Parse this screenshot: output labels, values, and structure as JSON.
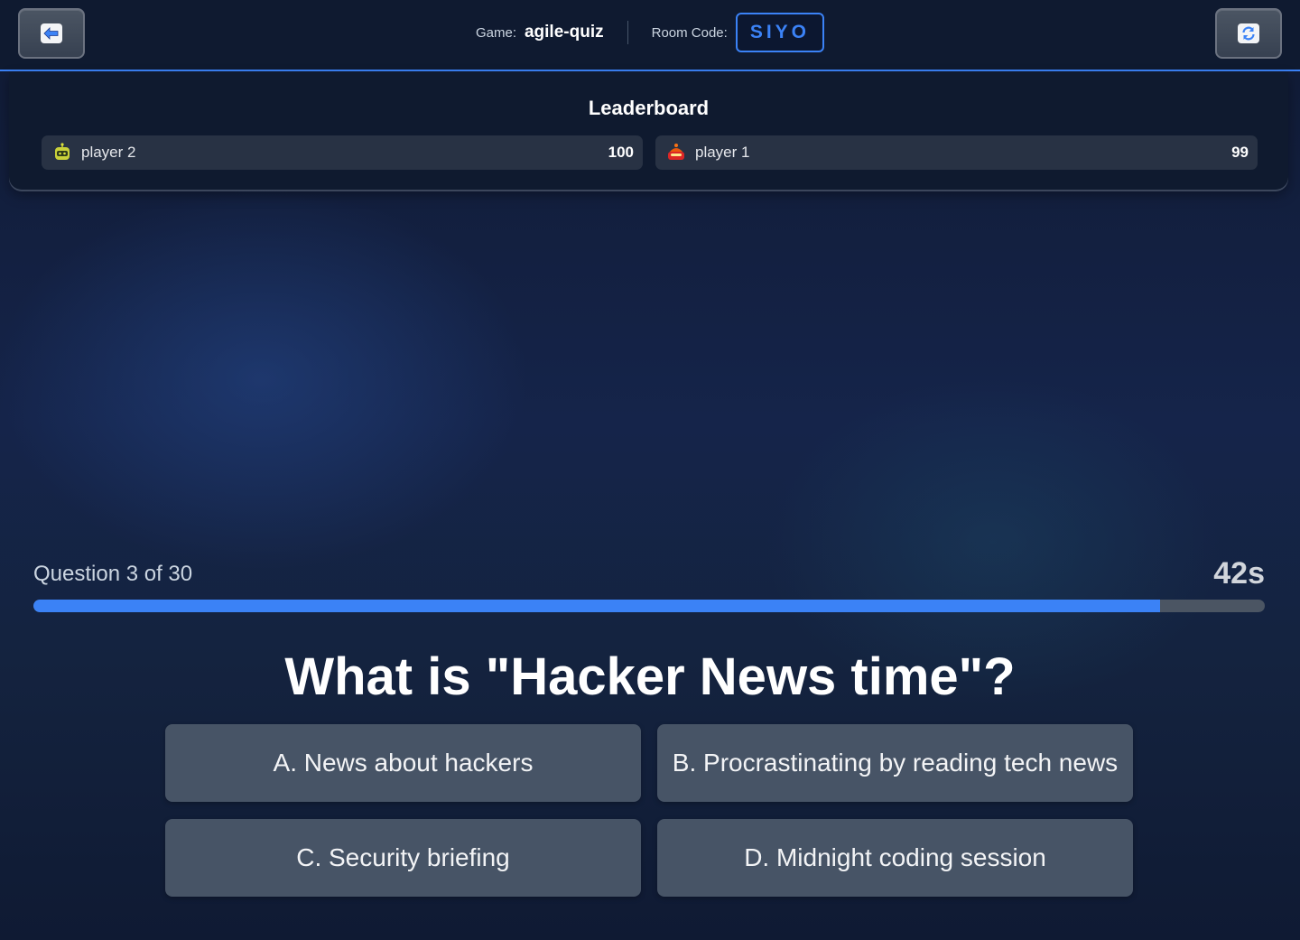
{
  "header": {
    "game_label": "Game:",
    "game_name": "agile-quiz",
    "room_label": "Room Code:",
    "room_code": "SIYO"
  },
  "icons": {
    "back": "back-arrow-icon",
    "refresh": "refresh-icon"
  },
  "leaderboard": {
    "title": "Leaderboard",
    "players": [
      {
        "name": "player 2",
        "score": "100",
        "avatar": "yellow-robot-avatar"
      },
      {
        "name": "player 1",
        "score": "99",
        "avatar": "red-robot-avatar"
      }
    ]
  },
  "quiz": {
    "question_counter": "Question 3 of 30",
    "timer": "42s",
    "time_progress": 0.915,
    "question": "What is \"Hacker News time\"?",
    "answers": [
      "A. News about hackers",
      "B. Procrastinating by reading tech news",
      "C. Security briefing",
      "D. Midnight coding session"
    ]
  },
  "colors": {
    "accent": "#3b82f6",
    "answer_bg": "#475466",
    "leaderboard_bg": "#0f1a2f"
  }
}
